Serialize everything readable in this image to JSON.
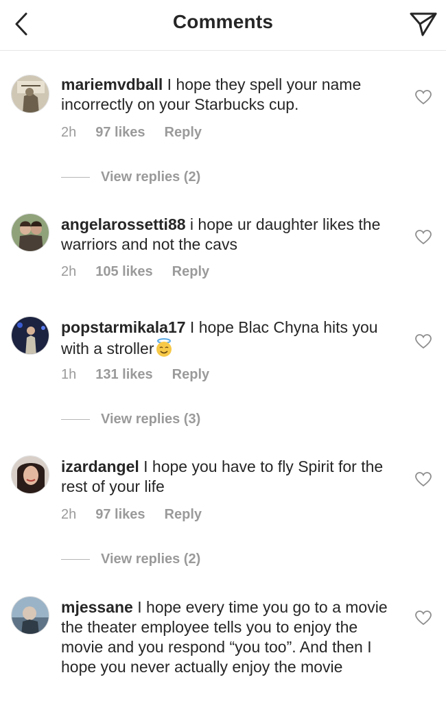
{
  "header": {
    "title": "Comments",
    "back_icon": "chevron-left-icon",
    "send_icon": "paper-plane-icon"
  },
  "colors": {
    "text": "#262626",
    "meta": "#9a9a9a",
    "divider": "#e6e6e6"
  },
  "comments": [
    {
      "username": "mariemvdball",
      "text": " I hope they spell your name incorrectly on your Starbucks cup.",
      "time": "2h",
      "likes": "97 likes",
      "reply": "Reply",
      "view_replies": "View replies (2)"
    },
    {
      "username": "angelarossetti88",
      "text": " i hope ur daughter likes the warriors and not the cavs",
      "time": "2h",
      "likes": "105 likes",
      "reply": "Reply"
    },
    {
      "username": "popstarmikala17",
      "text": " I hope Blac Chyna hits you with a stroller",
      "emoji": "smiling-face-with-halo-icon",
      "time": "1h",
      "likes": "131 likes",
      "reply": "Reply",
      "view_replies": "View replies (3)"
    },
    {
      "username": "izardangel",
      "text": " I hope you have to fly Spirit for the rest of your life",
      "time": "2h",
      "likes": "97 likes",
      "reply": "Reply",
      "view_replies": "View replies (2)"
    },
    {
      "username": "mjessane",
      "text": " I hope every time you go to a movie the theater employee tells you to enjoy the movie and you respond “you too”. And then I hope you never actually enjoy the movie"
    }
  ]
}
